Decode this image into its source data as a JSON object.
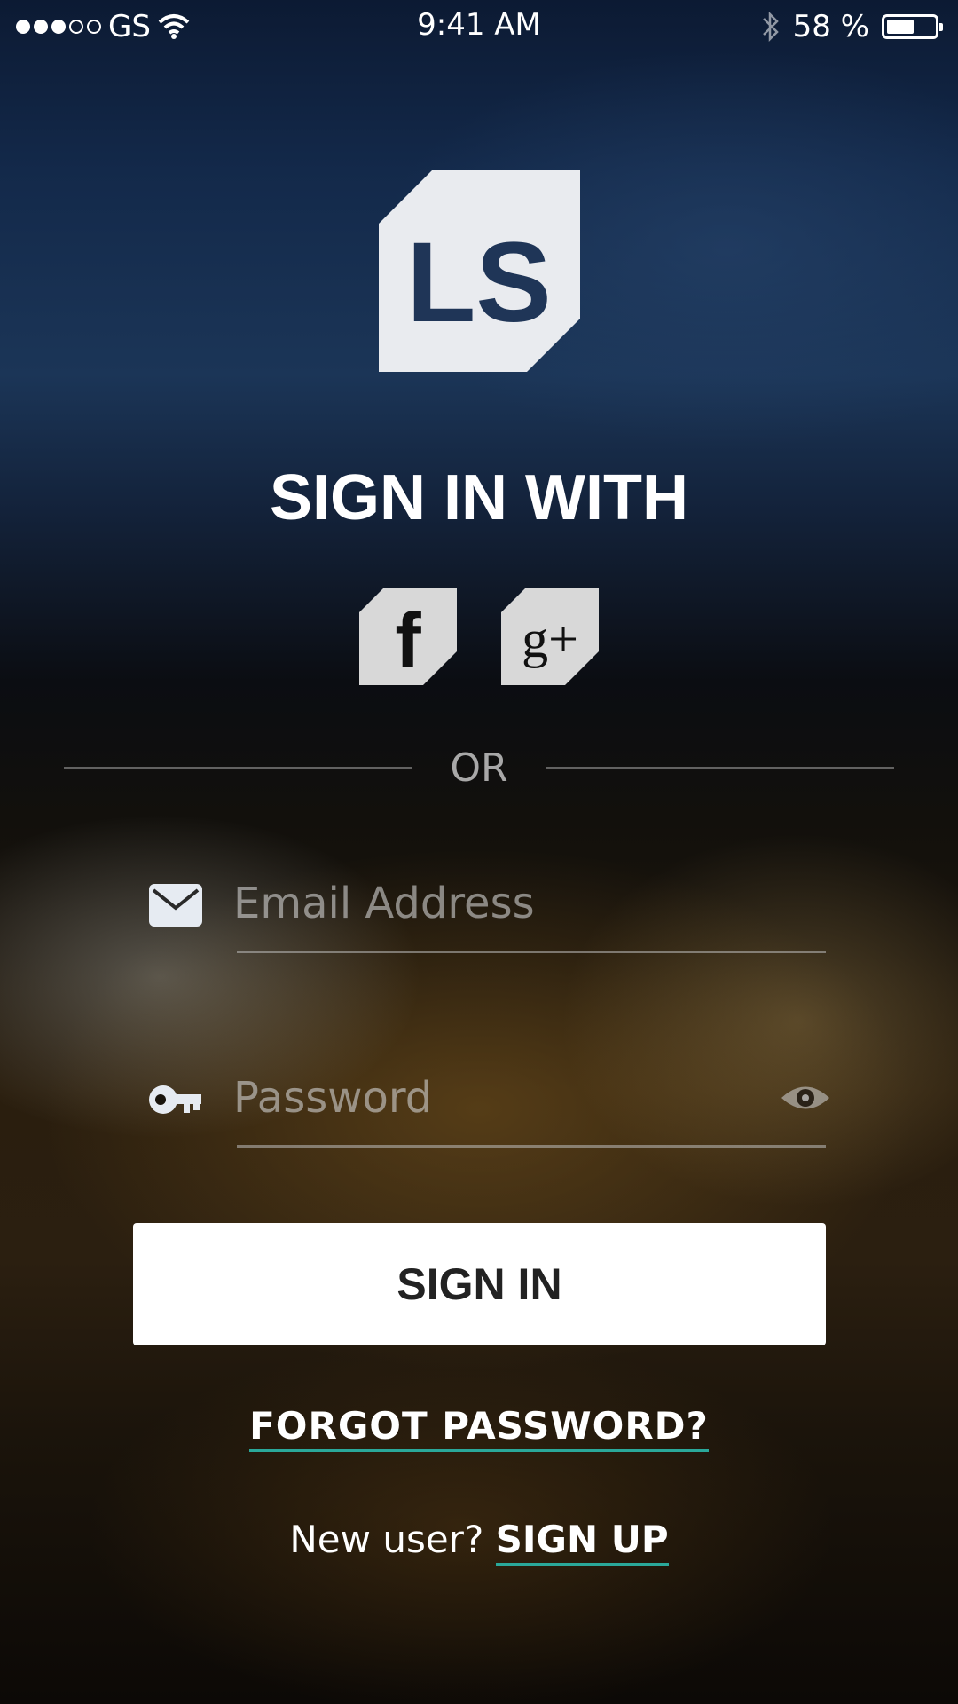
{
  "status_bar": {
    "carrier": "GS",
    "time": "9:41 AM",
    "battery": "58 %",
    "battery_level": 0.58
  },
  "logo": {
    "text": "LS"
  },
  "heading": "SIGN IN WITH",
  "social": {
    "facebook_glyph": "f",
    "google_glyph": "g+"
  },
  "divider_text": "OR",
  "email": {
    "placeholder": "Email Address",
    "value": ""
  },
  "password": {
    "placeholder": "Password",
    "value": ""
  },
  "signin_label": "SIGN IN",
  "forgot_label": "FORGOT PASSWORD?",
  "signup": {
    "prompt": "New user? ",
    "link": "SIGN UP"
  },
  "colors": {
    "accent": "#2aa89a",
    "logo_bg": "#e9ebef",
    "logo_fg": "#1f3557",
    "social_bg": "#d8d8d8"
  }
}
